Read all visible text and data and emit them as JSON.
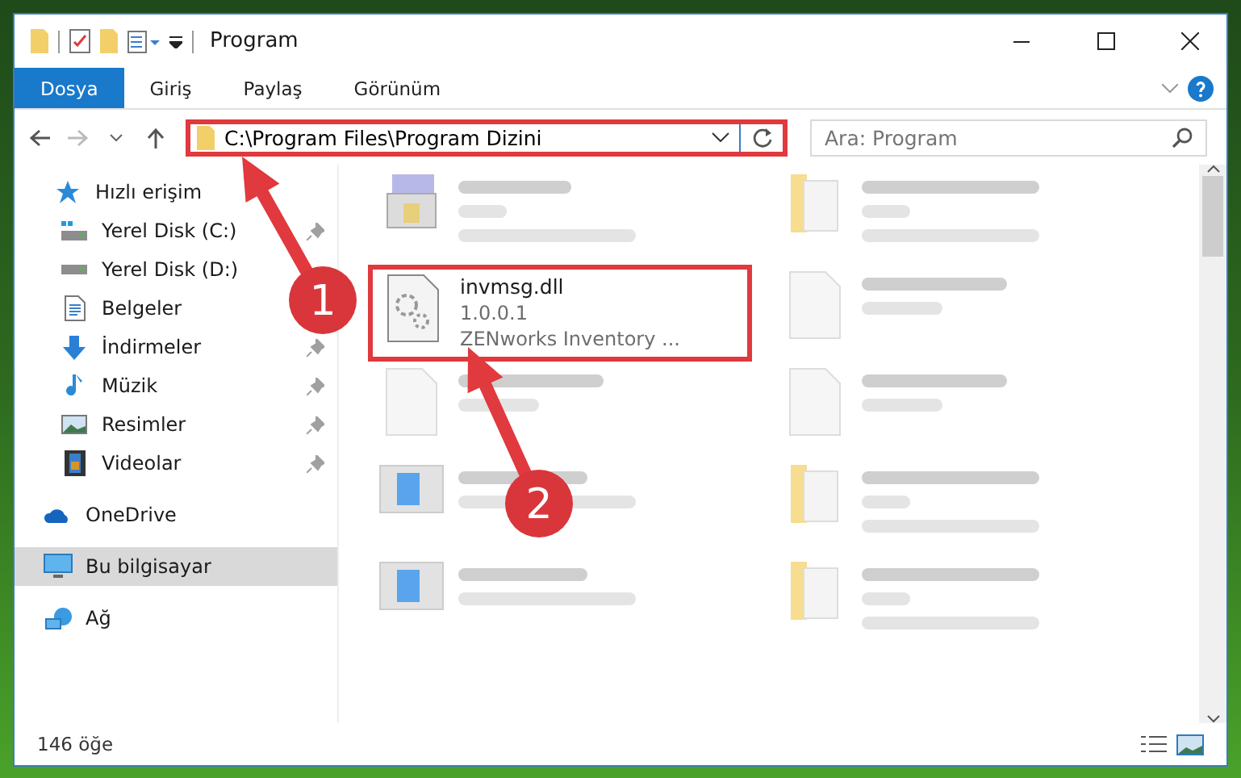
{
  "window": {
    "title": "Program"
  },
  "ribbon_tabs": [
    {
      "label": "Dosya",
      "selected": true
    },
    {
      "label": "Giriş",
      "selected": false
    },
    {
      "label": "Paylaş",
      "selected": false
    },
    {
      "label": "Görünüm",
      "selected": false
    }
  ],
  "address_bar": {
    "path": "C:\\Program Files\\Program Dizini",
    "highlighted": true
  },
  "search": {
    "placeholder": "Ara: Program"
  },
  "sidebar": {
    "items": [
      {
        "label": "Hızlı erişim",
        "selected": false,
        "children": [
          {
            "label": "Yerel Disk (C:)",
            "pinned": true,
            "selected": false
          },
          {
            "label": "Yerel Disk (D:)",
            "selected": false
          },
          {
            "label": "Belgeler",
            "selected": false
          },
          {
            "label": "İndirmeler",
            "pinned": true,
            "selected": false
          },
          {
            "label": "Müzik",
            "pinned": true,
            "selected": false
          },
          {
            "label": "Resimler",
            "pinned": true,
            "selected": false
          },
          {
            "label": "Videolar",
            "pinned": true,
            "selected": false
          }
        ]
      },
      {
        "label": "OneDrive",
        "selected": false
      },
      {
        "label": "Bu bilgisayar",
        "selected": true
      },
      {
        "label": "Ağ",
        "selected": false
      }
    ]
  },
  "files": [
    {
      "kind": "exe"
    },
    {
      "kind": "folder"
    },
    {
      "kind": "dll",
      "name": "invmsg.dll",
      "lines": [
        "1.0.0.1",
        "ZENworks Inventory ..."
      ],
      "highlighted": true
    },
    {
      "kind": "blank"
    },
    {
      "kind": "blank"
    },
    {
      "kind": "blank"
    },
    {
      "kind": "app"
    },
    {
      "kind": "folder"
    },
    {
      "kind": "app"
    },
    {
      "kind": "folder"
    }
  ],
  "status_bar": {
    "item_count": "146 öğe"
  },
  "annotations": [
    {
      "number": "1"
    },
    {
      "number": "2"
    }
  ]
}
